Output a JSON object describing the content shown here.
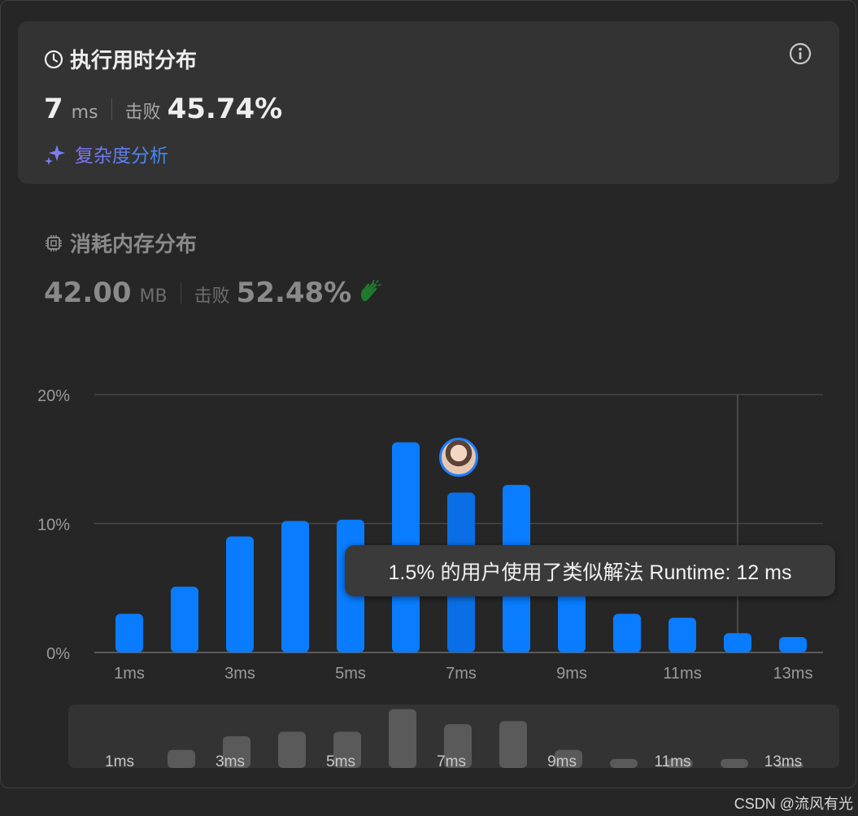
{
  "runtime": {
    "title": "执行用时分布",
    "value": "7",
    "unit": "ms",
    "beat_label": "击败",
    "beat_pct": "45.74%",
    "analysis_label": "复杂度分析"
  },
  "memory": {
    "title": "消耗内存分布",
    "value": "42.00",
    "unit": "MB",
    "beat_label": "击败",
    "beat_pct": "52.48%"
  },
  "tooltip_text": "1.5% 的用户使用了类似解法 Runtime: 12 ms",
  "watermark": "CSDN @流风有光",
  "colors": {
    "bar": "#0a7cff",
    "bar_selected": "#0a6fe6",
    "overview_bar": "#5a5a5a",
    "clap": "#1e7a2e"
  },
  "icons": {
    "runtime": "clock-icon",
    "info": "info-icon",
    "analysis": "sparkle-icon",
    "memory": "chip-icon",
    "clap": "clap-icon"
  },
  "chart_data": {
    "type": "bar",
    "x": [
      1,
      2,
      3,
      4,
      5,
      6,
      7,
      8,
      9,
      10,
      11,
      12,
      13
    ],
    "values": [
      3.0,
      5.1,
      9.0,
      10.2,
      10.3,
      16.3,
      12.4,
      13.0,
      5.0,
      3.0,
      2.7,
      1.5,
      1.2
    ],
    "ylim": [
      0,
      20
    ],
    "yticks": [
      "0%",
      "10%",
      "20%"
    ],
    "xticks": [
      "1ms",
      "3ms",
      "5ms",
      "7ms",
      "9ms",
      "11ms",
      "13ms"
    ],
    "selected_x": 7,
    "hover_x": 12,
    "grid": true,
    "overview_values": [
      0.0,
      1.2,
      2.1,
      2.4,
      2.4,
      3.9,
      2.9,
      3.1,
      1.2,
      0.6,
      0.6,
      0.6,
      0.3
    ]
  }
}
